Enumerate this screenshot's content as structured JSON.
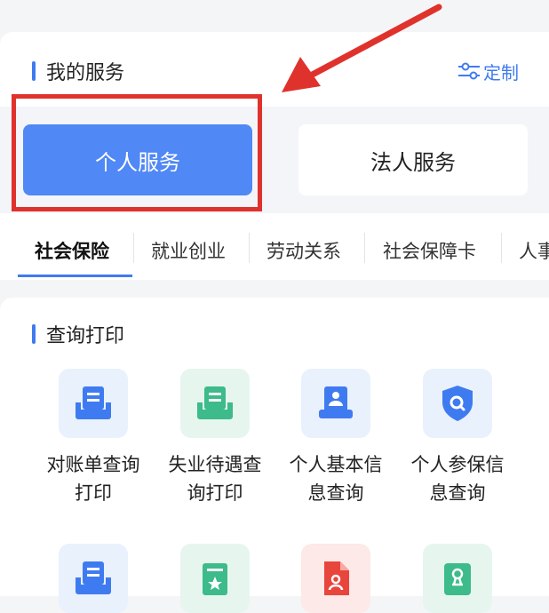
{
  "my_services": {
    "title": "我的服务",
    "customize_label": "定制"
  },
  "service_toggle": {
    "personal": "个人服务",
    "legal": "法人服务",
    "selected": "个人服务"
  },
  "category_tabs": [
    {
      "label": "社会保险",
      "active": true
    },
    {
      "label": "就业创业",
      "active": false
    },
    {
      "label": "劳动关系",
      "active": false
    },
    {
      "label": "社会保障卡",
      "active": false
    },
    {
      "label": "人事",
      "active": false
    }
  ],
  "query_print": {
    "title": "查询打印",
    "items": [
      {
        "line1": "对账单查询",
        "line2": "打印",
        "icon": "statement-print-icon"
      },
      {
        "line1": "失业待遇查",
        "line2": "询打印",
        "icon": "unemployment-print-icon"
      },
      {
        "line1": "个人基本信",
        "line2": "息查询",
        "icon": "personal-info-icon"
      },
      {
        "line1": "个人参保信",
        "line2": "息查询",
        "icon": "insurance-shield-icon"
      }
    ],
    "items_row2_icons": [
      "print-icon",
      "certificate-star-icon",
      "pdf-document-icon",
      "approval-stamp-icon"
    ]
  },
  "colors": {
    "accent": "#3f7bf0",
    "selected_button": "#5088f5",
    "annotation_red": "#e0322c",
    "icon_green": "#3dbb8a",
    "icon_red": "#e8453c"
  }
}
